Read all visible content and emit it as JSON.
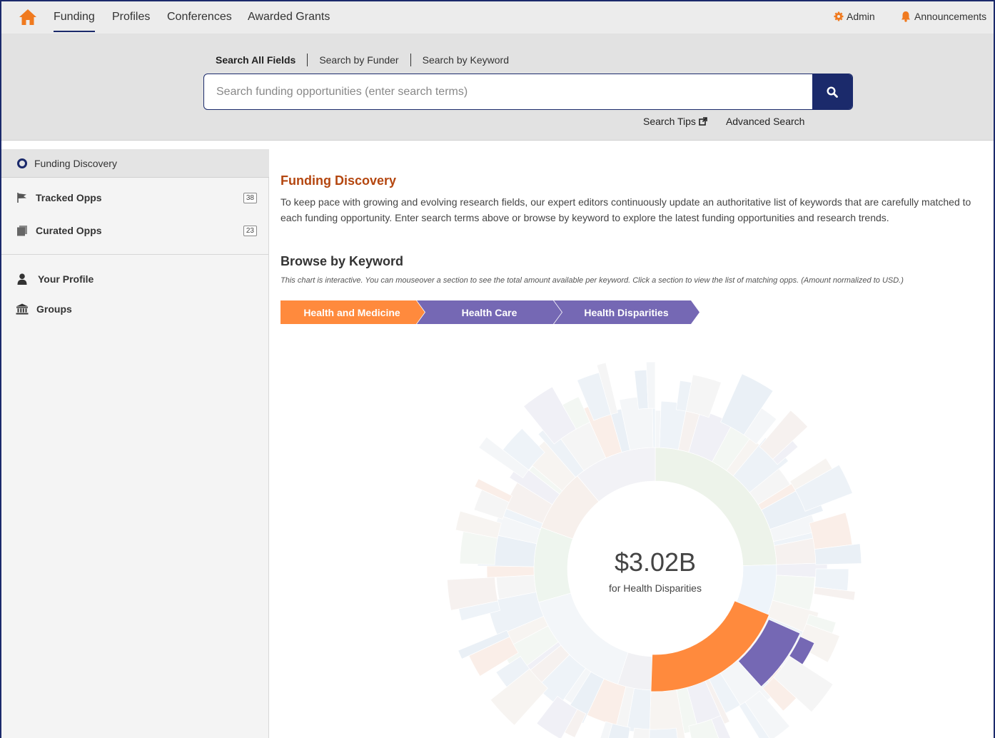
{
  "topnav": {
    "tabs": [
      {
        "label": "Funding",
        "active": true
      },
      {
        "label": "Profiles"
      },
      {
        "label": "Conferences"
      },
      {
        "label": "Awarded Grants"
      }
    ],
    "admin_label": "Admin",
    "announcements_label": "Announcements"
  },
  "search": {
    "tabs": [
      "Search All Fields",
      "Search by Funder",
      "Search by Keyword"
    ],
    "active_tab": "Search All Fields",
    "placeholder": "Search funding opportunities (enter search terms)",
    "value": "",
    "tips_label": "Search Tips",
    "advanced_label": "Advanced Search"
  },
  "sidebar": {
    "items": [
      {
        "label": "Funding Discovery",
        "icon": "eye-icon",
        "active": true
      },
      {
        "label": "Tracked Opps",
        "icon": "flag-icon",
        "count": "38"
      },
      {
        "label": "Curated Opps",
        "icon": "documents-icon",
        "count": "23"
      },
      {
        "label": "Your Profile",
        "icon": "user-icon"
      },
      {
        "label": "Groups",
        "icon": "institution-icon"
      }
    ]
  },
  "main": {
    "title": "Funding Discovery",
    "description": "To keep pace with growing and evolving research fields, our expert editors continuously update an authoritative list of keywords that are carefully matched to each funding opportunity. Enter search terms above or browse by keyword to explore the latest funding opportunities and research trends.",
    "browse_title": "Browse by Keyword",
    "browse_note": "This chart is interactive. You can mouseover a section to see the total amount available per keyword. Click a section to view the list of matching opps. (Amount normalized to USD.)",
    "breadcrumbs": [
      "Health and Medicine",
      "Health Care",
      "Health Disparities"
    ],
    "center_amount": "$3.02B",
    "center_label": "for Health Disparities"
  },
  "colors": {
    "brand_navy": "#1b2a6b",
    "accent_orange": "#ff8a3d",
    "accent_purple": "#7568b4",
    "title_orange": "#b4460f"
  }
}
